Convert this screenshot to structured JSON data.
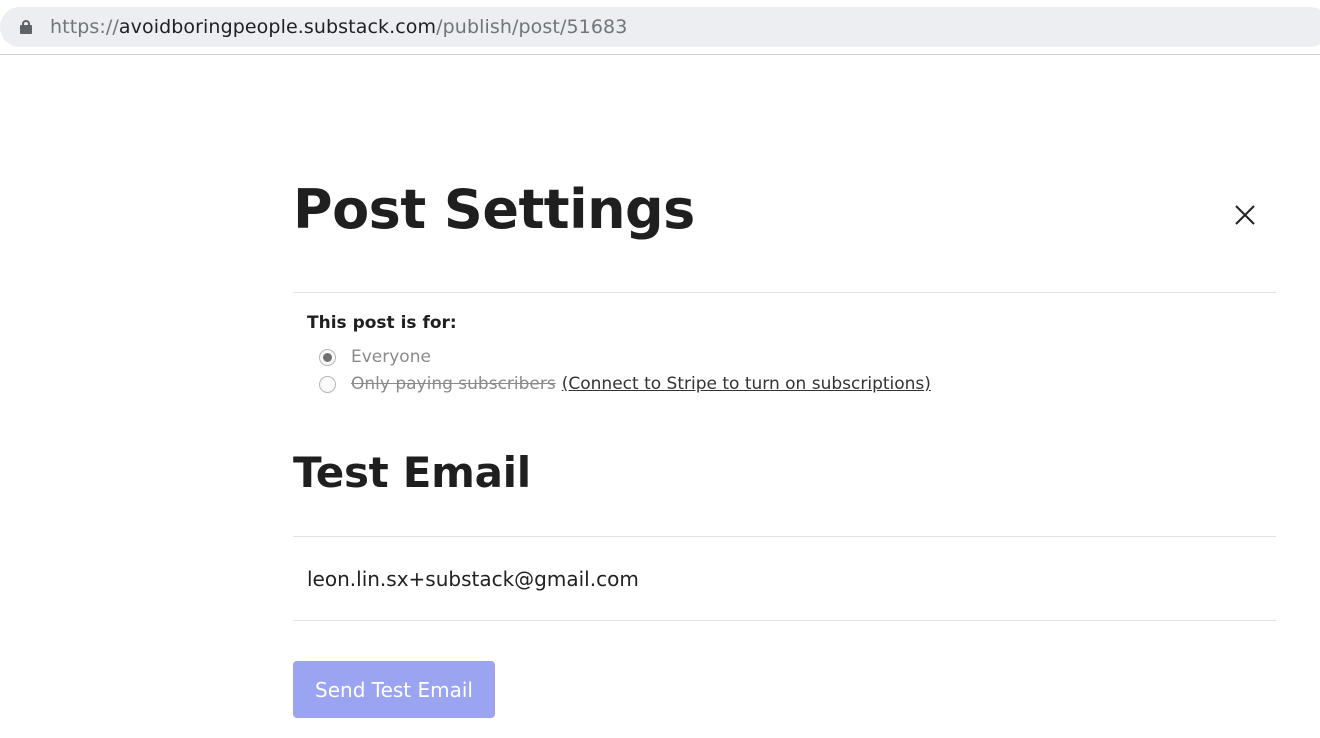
{
  "browser": {
    "url_scheme": "https://",
    "url_host": "avoidboringpeople.substack.com",
    "url_path": "/publish/post/51683"
  },
  "modal": {
    "title": "Post Settings",
    "audience": {
      "label": "This post is for:",
      "options": [
        {
          "label": "Everyone",
          "selected": true
        },
        {
          "label": "Only paying subscribers",
          "selected": false,
          "disabled": true
        }
      ],
      "stripe_link": "(Connect to Stripe to turn on subscriptions)"
    },
    "test_email": {
      "title": "Test Email",
      "input_value": "leon.lin.sx+substack@gmail.com",
      "send_button": "Send Test Email"
    }
  },
  "colors": {
    "button_bg": "#9ba4f0",
    "title_text": "#1f1f1f"
  }
}
